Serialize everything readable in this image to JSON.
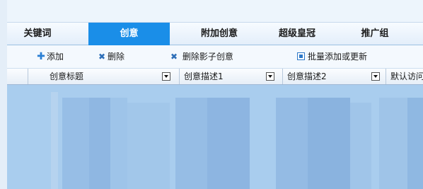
{
  "tabs": [
    {
      "label": "关键词"
    },
    {
      "label": "创意"
    },
    {
      "label": "附加创意"
    },
    {
      "label": "超级皇冠"
    },
    {
      "label": "推广组"
    }
  ],
  "active_tab": "创意",
  "toolbar": {
    "add_label": "添加",
    "delete_label": "删除",
    "delete_shadow_label": "删除影子创意",
    "batch_label": "批量添加或更新"
  },
  "table": {
    "columns": [
      {
        "label": "创意标题"
      },
      {
        "label": "创意描述1"
      },
      {
        "label": "创意描述2"
      },
      {
        "label": "默认访问"
      }
    ]
  },
  "colors": {
    "accent": "#1a8ee8",
    "grid_bg": "#a9cdee"
  }
}
